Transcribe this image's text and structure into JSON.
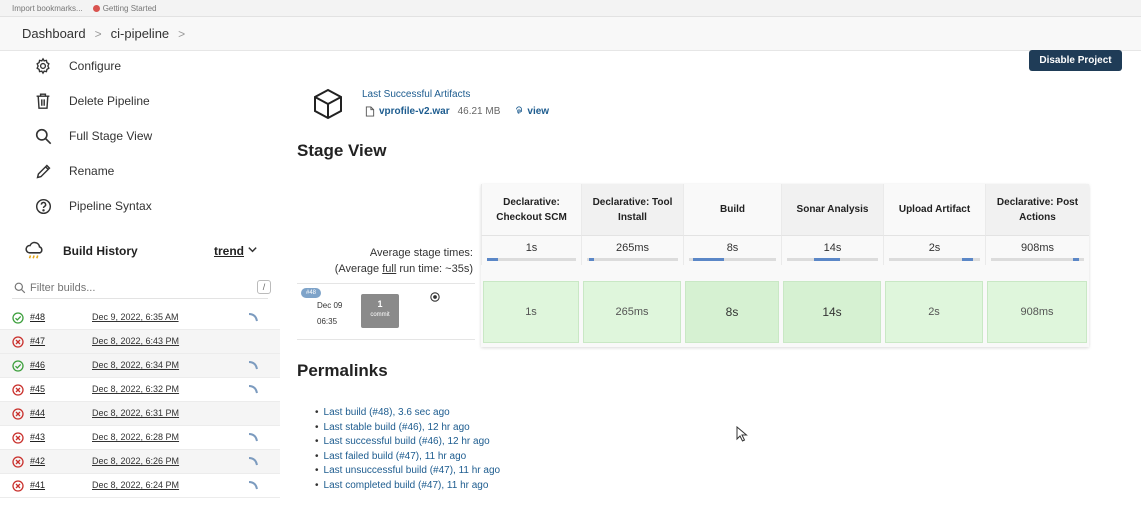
{
  "bookmarks": [
    "Import bookmarks...",
    "Getting Started"
  ],
  "breadcrumb": [
    "Dashboard",
    "ci-pipeline"
  ],
  "disable_project": "Disable Project",
  "sidebar": {
    "tasks": [
      {
        "label": "Configure",
        "icon": "gear-icon"
      },
      {
        "label": "Delete Pipeline",
        "icon": "trash-icon"
      },
      {
        "label": "Full Stage View",
        "icon": "search-icon"
      },
      {
        "label": "Rename",
        "icon": "pencil-icon"
      },
      {
        "label": "Pipeline Syntax",
        "icon": "help-icon"
      }
    ],
    "build_history": {
      "title": "Build History",
      "trend": "trend",
      "filter_placeholder": "Filter builds...",
      "filter_shortcut": "/"
    },
    "builds": [
      {
        "num": "#48",
        "date": "Dec 9, 2022, 6:35 AM",
        "status": "success"
      },
      {
        "num": "#47",
        "date": "Dec 8, 2022, 6:43 PM",
        "status": "failed"
      },
      {
        "num": "#46",
        "date": "Dec 8, 2022, 6:34 PM",
        "status": "success"
      },
      {
        "num": "#45",
        "date": "Dec 8, 2022, 6:32 PM",
        "status": "failed"
      },
      {
        "num": "#44",
        "date": "Dec 8, 2022, 6:31 PM",
        "status": "failed"
      },
      {
        "num": "#43",
        "date": "Dec 8, 2022, 6:28 PM",
        "status": "failed"
      },
      {
        "num": "#42",
        "date": "Dec 8, 2022, 6:26 PM",
        "status": "failed"
      },
      {
        "num": "#41",
        "date": "Dec 8, 2022, 6:24 PM",
        "status": "failed"
      }
    ]
  },
  "artifacts": {
    "title": "Last Successful Artifacts",
    "file": "vprofile-v2.war",
    "size": "46.21 MB",
    "view": "view"
  },
  "stage_view": {
    "title": "Stage View",
    "avg_label": "Average stage times:",
    "avg_full_prefix": "(Average ",
    "avg_full_word": "full",
    "avg_full_suffix": " run time: ~35s)",
    "stages": [
      {
        "name": "Declarative: Checkout SCM",
        "avg": "1s",
        "run": "1s"
      },
      {
        "name": "Declarative: Tool Install",
        "avg": "265ms",
        "run": "265ms"
      },
      {
        "name": "Build",
        "avg": "8s",
        "run": "8s"
      },
      {
        "name": "Sonar Analysis",
        "avg": "14s",
        "run": "14s"
      },
      {
        "name": "Upload Artifact",
        "avg": "2s",
        "run": "2s"
      },
      {
        "name": "Declarative: Post Actions",
        "avg": "908ms",
        "run": "908ms"
      }
    ],
    "run": {
      "badge": "#48",
      "date": "Dec 09",
      "time": "06:35",
      "commit_count": "1",
      "commit_label": "commit"
    }
  },
  "permalinks": {
    "title": "Permalinks",
    "items": [
      "Last build (#48), 3.6 sec ago",
      "Last stable build (#46), 12 hr ago",
      "Last successful build (#46), 12 hr ago",
      "Last failed build (#47), 11 hr ago",
      "Last unsuccessful build (#47), 11 hr ago",
      "Last completed build (#47), 11 hr ago"
    ]
  },
  "colors": {
    "link": "#1d5c8f",
    "button": "#1f3c57",
    "success": "#3c9f3c",
    "failed": "#c9302c",
    "stage_cell": "#dff6dc"
  }
}
